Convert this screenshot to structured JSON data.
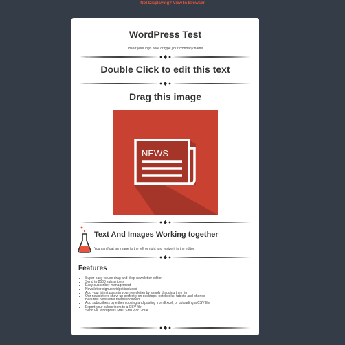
{
  "header": {
    "view_in_browser": "Not Displaying? View In Browser"
  },
  "newsletter": {
    "title": "WordPress Test",
    "tagline": "Insert your logo here or type your company name",
    "edit_heading": "Double Click to edit this text",
    "image_heading": "Drag this image",
    "image": {
      "label": "NEWS",
      "icon": "newspaper-icon",
      "bg_color": "#c84131"
    },
    "text_images": {
      "icon": "flask-icon",
      "title": "Text And Images Working together",
      "description": "You can float an image to the left or right and resize it in the editor."
    },
    "features": {
      "title": "Features",
      "items": [
        "Super easy to use drag and drop newsletter editor",
        "Send to 2500 subscribers",
        "Easy subscriber management",
        "Newsletter signup widget included",
        "Add your latest posts in your newsletter by simply dragging them in",
        "Our newsletters show up perfectly on desktops, notebooks, tablets and phones",
        "Beautiful newsletter theme included",
        "Add subscribers by either copying and pasting from Excel, or uploading a CSV file",
        "Export your subscribers to a CSV file",
        "Send via Wordpress Mail, SMTP or Gmail"
      ]
    }
  },
  "colors": {
    "background": "#333c47",
    "accent": "#e8543e",
    "card": "#ffffff"
  }
}
